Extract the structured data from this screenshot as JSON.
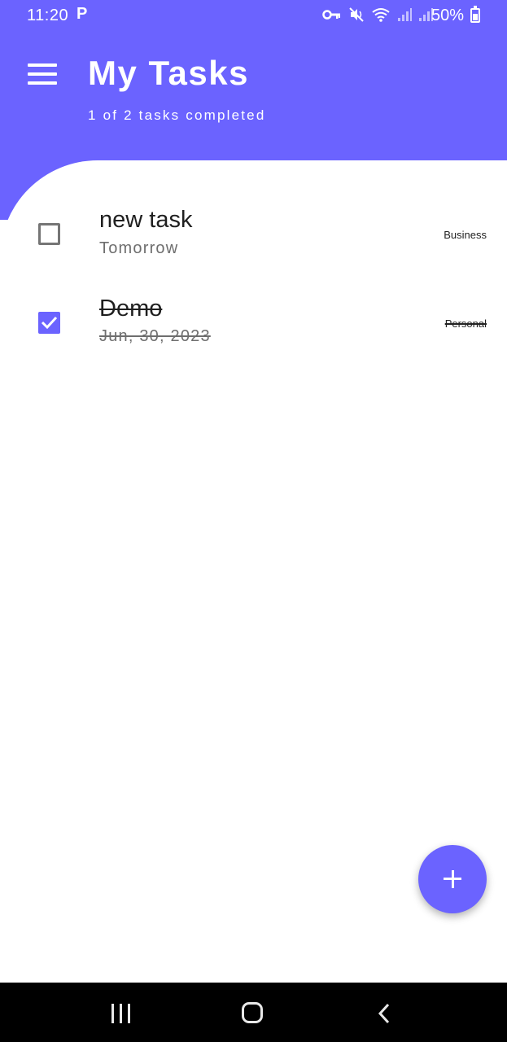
{
  "status_bar": {
    "time": "11:20",
    "app_indicator": "P",
    "icons": [
      "vpn-key-icon",
      "mute-icon",
      "wifi-icon",
      "signal-icon",
      "signal-icon"
    ],
    "battery_percent": "50%"
  },
  "header": {
    "title": "My Tasks",
    "subtitle": "1 of 2 tasks completed",
    "background_color": "#6B63FF"
  },
  "tasks": [
    {
      "title": "new task",
      "date": "Tomorrow",
      "category": "Business",
      "completed": false
    },
    {
      "title": "Demo",
      "date": "Jun, 30, 2023",
      "category": "Personal",
      "completed": true
    }
  ],
  "fab": {
    "icon": "plus-icon",
    "color": "#6B63FF"
  },
  "nav_bar": {
    "buttons": [
      "recent-apps-icon",
      "home-icon",
      "back-icon"
    ]
  }
}
